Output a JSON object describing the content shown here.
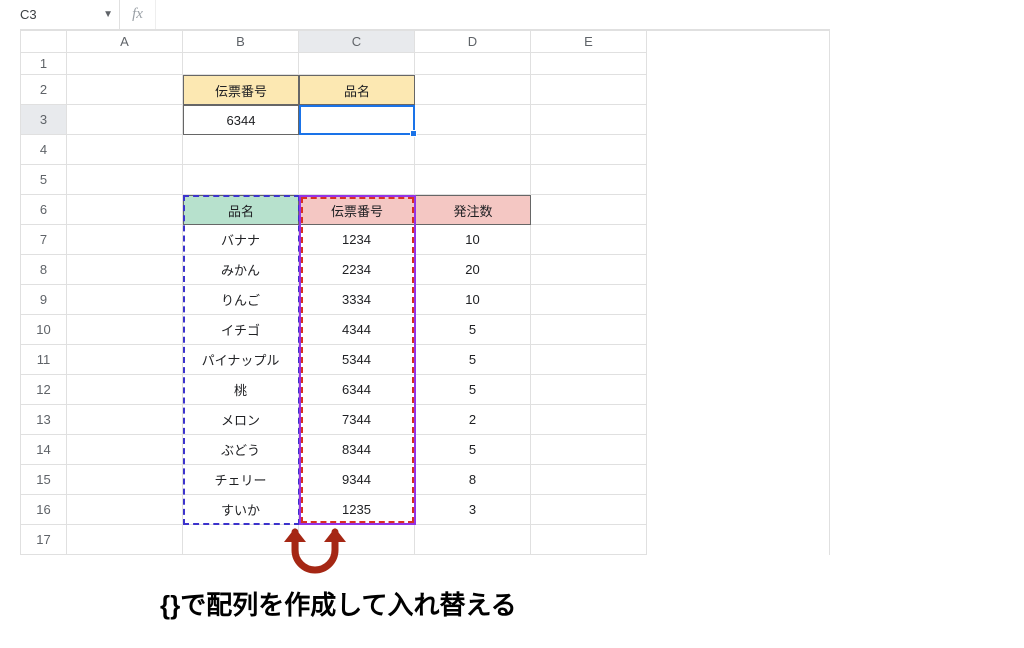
{
  "namebox": {
    "value": "C3"
  },
  "cols": [
    "A",
    "B",
    "C",
    "D",
    "E"
  ],
  "rows": [
    "1",
    "2",
    "3",
    "4",
    "5",
    "6",
    "7",
    "8",
    "9",
    "10",
    "11",
    "12",
    "13",
    "14",
    "15",
    "16",
    "17"
  ],
  "top": {
    "h1": "伝票番号",
    "h2": "品名",
    "v1": "6344"
  },
  "tbl": {
    "h_name": "品名",
    "h_slip": "伝票番号",
    "h_qty": "発注数",
    "rows": [
      {
        "name": "バナナ",
        "slip": "1234",
        "qty": "10"
      },
      {
        "name": "みかん",
        "slip": "2234",
        "qty": "20"
      },
      {
        "name": "りんご",
        "slip": "3334",
        "qty": "10"
      },
      {
        "name": "イチゴ",
        "slip": "4344",
        "qty": "5"
      },
      {
        "name": "パイナップル",
        "slip": "5344",
        "qty": "5"
      },
      {
        "name": "桃",
        "slip": "6344",
        "qty": "5"
      },
      {
        "name": "メロン",
        "slip": "7344",
        "qty": "2"
      },
      {
        "name": "ぶどう",
        "slip": "8344",
        "qty": "5"
      },
      {
        "name": "チェリー",
        "slip": "9344",
        "qty": "8"
      },
      {
        "name": "すいか",
        "slip": "1235",
        "qty": "3"
      }
    ]
  },
  "annotation": "{}で配列を作成して入れ替える"
}
